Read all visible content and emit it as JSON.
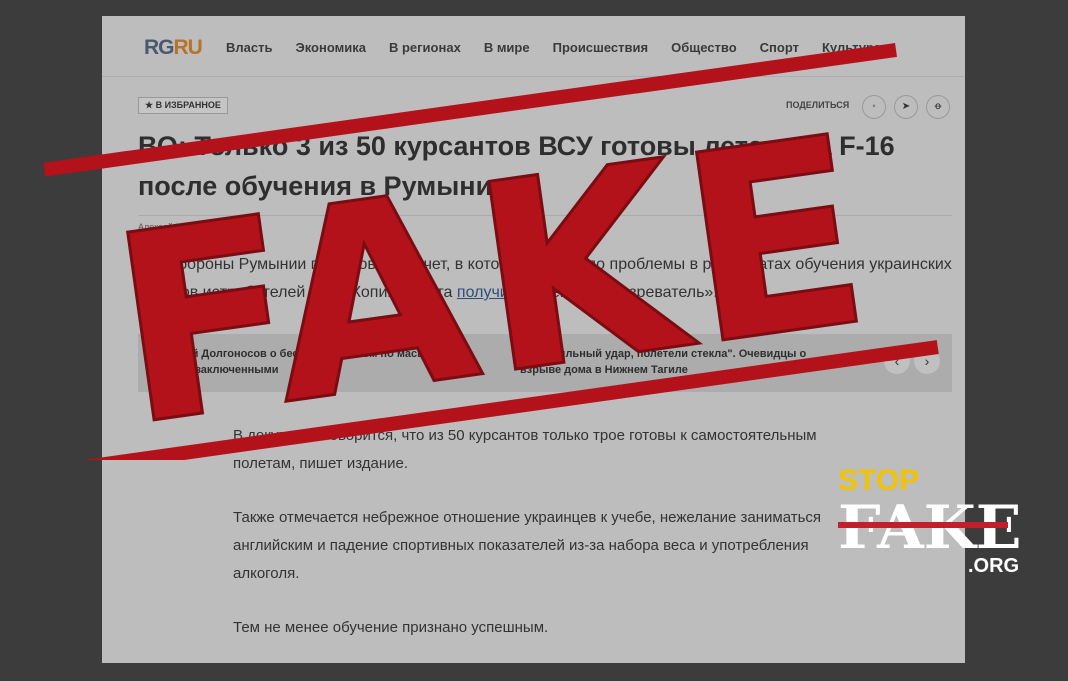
{
  "site": {
    "logo_rg": "RG",
    "logo_ru": "RU",
    "nav": [
      "Власть",
      "Экономика",
      "В регионах",
      "В мире",
      "Происшествия",
      "Общество",
      "Спорт",
      "Культура"
    ]
  },
  "article": {
    "favorite_label": "★ В ИЗБРАННОЕ",
    "share_label": "ПОДЕЛИТЬСЯ",
    "share_icons": [
      "vk-icon",
      "telegram-icon",
      "ok-icon"
    ],
    "headline": "ВО: Только 3 из 50 курсантов ВСУ готовы летать на F-16 после обучения в Румынии",
    "author": "Алексей Комолов",
    "lead_start": "Минобороны Румынии подготовило отчет, в котором изложило проблемы в результатах обучения украинских пилотов истребителей F-16. Копию отчета ",
    "lead_link": "получил",
    "lead_end": " «Военный обозреватель».",
    "related": [
      "Николай Долгоносов о беспрецедентном по масштабу обмене заключенными",
      "\"Был сильный удар, полетели стекла\". Очевидцы о взрыве дома в Нижнем Тагиле"
    ],
    "paragraphs": [
      "В документе говорится, что из 50 курсантов только трое готовы к самостоятельным полетам, пишет издание.",
      "Также отмечается небрежное отношение украинцев к учебе, нежелание заниматься английским и падение спортивных показателей из-за набора веса и употребления алкоголя.",
      "Тем не менее обучение признано успешным."
    ]
  },
  "overlay": {
    "stamp_text": "FAKE",
    "stamp_color": "#b3121b",
    "brand_stop": "STOP",
    "brand_fake": "FAKE",
    "brand_org": ".ORG",
    "brand_yellow": "#f2c300"
  }
}
